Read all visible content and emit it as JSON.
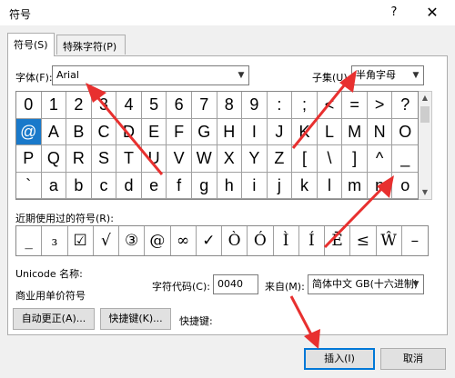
{
  "window": {
    "title": "符号",
    "help": "?",
    "close": "✕"
  },
  "tabs": [
    {
      "label": "符号(S)"
    },
    {
      "label": "特殊字符(P)"
    }
  ],
  "font": {
    "label": "字体(F):",
    "value": "Arial"
  },
  "subset": {
    "label": "子集(U):",
    "value": "半角字母"
  },
  "symbols": [
    "0",
    "1",
    "2",
    "3",
    "4",
    "5",
    "6",
    "7",
    "8",
    "9",
    ":",
    ";",
    "<",
    "=",
    ">",
    "?",
    "@",
    "A",
    "B",
    "C",
    "D",
    "E",
    "F",
    "G",
    "H",
    "I",
    "J",
    "K",
    "L",
    "M",
    "N",
    "O",
    "P",
    "Q",
    "R",
    "S",
    "T",
    "U",
    "V",
    "W",
    "X",
    "Y",
    "Z",
    "[",
    "\\",
    "]",
    "^",
    "_",
    "`",
    "a",
    "b",
    "c",
    "d",
    "e",
    "f",
    "g",
    "h",
    "i",
    "j",
    "k",
    "l",
    "m",
    "n",
    "o"
  ],
  "selected_index": 16,
  "recent": {
    "label": "近期使用过的符号(R):",
    "items": [
      "_",
      "₃",
      "☑",
      "√",
      "③",
      "@",
      "∞",
      "✓",
      "Ò",
      "Ó",
      "Ì",
      "Í",
      "Ē",
      "≤",
      "Ŵ",
      "–"
    ]
  },
  "unicode": {
    "name_label": "Unicode 名称:",
    "desc": "商业用单价符号"
  },
  "char_code": {
    "label": "字符代码(C):",
    "value": "0040"
  },
  "from": {
    "label": "来自(M):",
    "value": "简体中文 GB(十六进制)"
  },
  "buttons": {
    "autocorrect": "自动更正(A)...",
    "shortcut": "快捷键(K)...",
    "shortcut_label": "快捷键:",
    "insert": "插入(I)",
    "cancel": "取消"
  },
  "colors": {
    "selection": "#1979ca",
    "annotation": "#e8302f"
  }
}
